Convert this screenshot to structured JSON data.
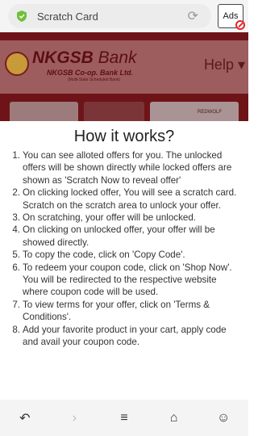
{
  "browser": {
    "url_title": "Scratch Card",
    "reload_icon": "reload-icon",
    "ads_label": "Ads"
  },
  "site": {
    "bank_name_bold": "NKGSB",
    "bank_name_rest": " Bank",
    "bank_subtitle": "NKGSB Co-op. Bank Ltd.",
    "bank_note": "(Multi-State Scheduled Bank)",
    "help_label": "Help ▾",
    "banner_text": "REDWOLF"
  },
  "modal": {
    "close_icon": "×",
    "title": "How it works?",
    "steps": [
      {
        "num": "1.",
        "text": "You can see alloted offers for you. The unlocked offers will be shown directly while locked offers are shown as 'Scratch Now to reveal offer'"
      },
      {
        "num": "2.",
        "text": "On clicking locked offer, You will see a scratch card. Scratch on the scratch area to unlock your offer."
      },
      {
        "num": "3.",
        "text": "On scratching, your offer will be unlocked."
      },
      {
        "num": "4.",
        "text": "On clicking on unlocked offer, your offer will be showed directly."
      },
      {
        "num": "5.",
        "text": "To copy the code, click on 'Copy Code'."
      },
      {
        "num": "6.",
        "text": "To redeem your coupon code, click on 'Shop Now'. You will be redirected to the respective website where coupon code will be used."
      },
      {
        "num": "7.",
        "text": "To view terms for your offer, click on 'Terms & Conditions'."
      },
      {
        "num": "8.",
        "text": "Add your favorite product in your cart, apply code and avail your coupon code."
      }
    ]
  },
  "nav": {
    "back": "↶",
    "forward": "›",
    "menu": "≡",
    "home": "⌂",
    "tabs": "☺"
  },
  "colors": {
    "site_bg": "#6e1418",
    "shield": "#6fbf3b",
    "no_sign": "#e0262a"
  }
}
